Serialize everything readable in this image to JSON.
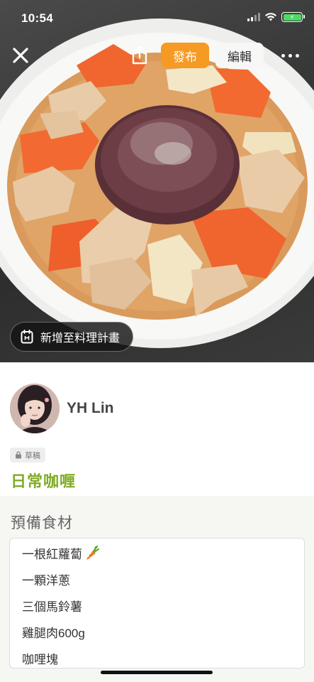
{
  "status_bar": {
    "time": "10:54",
    "battery_icon": "battery-charging-icon"
  },
  "toolbar": {
    "close_icon": "close-icon",
    "share_icon": "share-icon",
    "publish_label": "發布",
    "edit_label": "編輯",
    "more_icon": "more-icon",
    "accent_color": "#f59a23"
  },
  "hero": {
    "plan_button_label": "新增至料理計畫",
    "plan_icon": "calendar-icon"
  },
  "author": {
    "name": "YH Lin"
  },
  "recipe": {
    "status_badge": "草稿",
    "title": "日常咖喱",
    "title_color": "#7fab26"
  },
  "ingredients": {
    "heading": "預備食材",
    "items": [
      "一根紅蘿蔔",
      "一顆洋蔥",
      "三個馬鈴薯",
      "雞腿肉600g",
      "咖哩塊"
    ]
  }
}
